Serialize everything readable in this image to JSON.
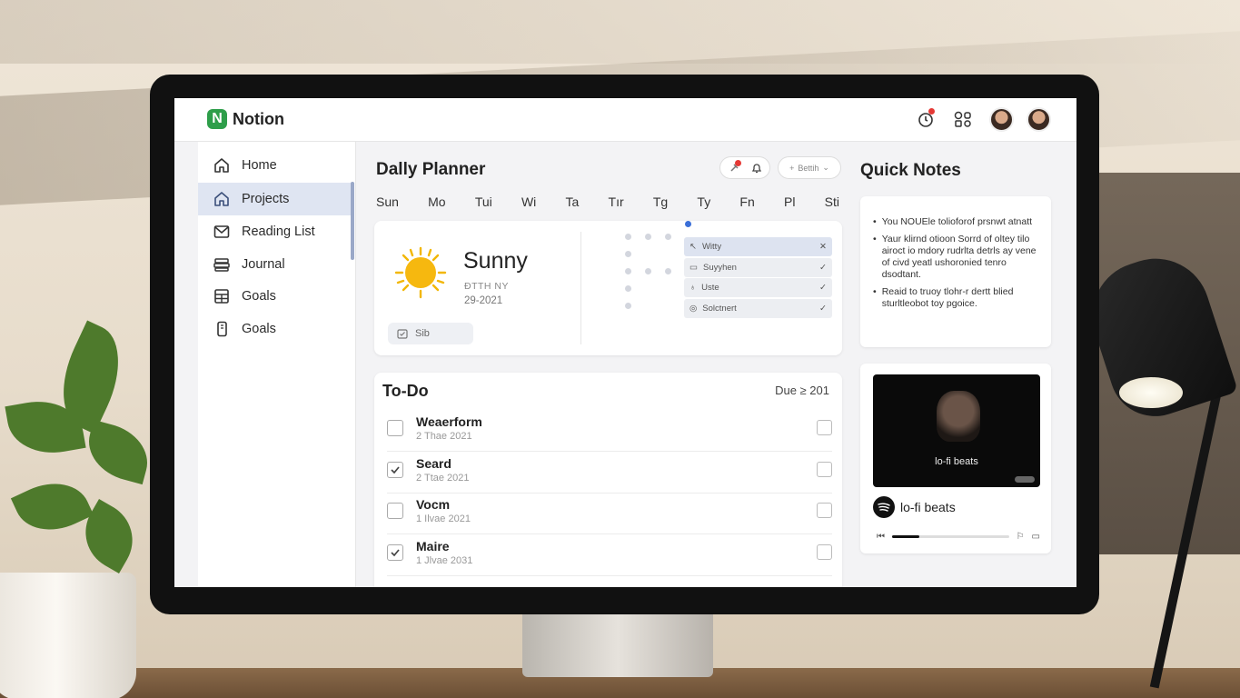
{
  "app": {
    "name": "Notion"
  },
  "sidebar": {
    "items": [
      {
        "label": "Home",
        "icon": "home-icon"
      },
      {
        "label": "Projects",
        "icon": "home-icon",
        "active": true
      },
      {
        "label": "Reading List",
        "icon": "mail-icon"
      },
      {
        "label": "Journal",
        "icon": "stack-icon"
      },
      {
        "label": "Goals",
        "icon": "table-icon"
      },
      {
        "label": "Goals",
        "icon": "phone-icon"
      }
    ]
  },
  "planner": {
    "title": "Dally Planner",
    "filter_label": "Bettih",
    "days": [
      "Sun",
      "Mo",
      "Tui",
      "Wi",
      "Ta",
      "Tır",
      "Tg",
      "Ty",
      "Fn",
      "Pl",
      "Sti"
    ]
  },
  "weather": {
    "condition": "Sunny",
    "meta1": "ÐTTH NY",
    "meta2": "29-2021",
    "chip": "Sib",
    "list": [
      {
        "label": "Witty",
        "mark": "✕"
      },
      {
        "label": "Suyyhen",
        "mark": "✓"
      },
      {
        "label": "Uste",
        "mark": "✓"
      },
      {
        "label": "Solctnert",
        "mark": "✓"
      }
    ]
  },
  "todo": {
    "title": "To-Do",
    "due": "Due ≥ 201",
    "rows": [
      {
        "name": "Weaerform",
        "date": "2 Thae 2021",
        "checked": false
      },
      {
        "name": "Seard",
        "date": "2 Ttae 2021",
        "checked": true
      },
      {
        "name": "Vocm",
        "date": "1 Ilvae 2021",
        "checked": false
      },
      {
        "name": "Maire",
        "date": "1 Jlvae 2031",
        "checked": true
      }
    ]
  },
  "quick_notes": {
    "title": "Quick Notes",
    "notes": [
      "You NOUEle tolioforof prsnwt atnatt",
      "Yaur klirnd otioon Sorrd of oltey tilo airoct io mdory rudrlta detrls ay vene of civd yeatl ushoronied tenro dsodtant.",
      "Reaid to truoy tlohr-r dertt blied sturltleobot toy pgoice."
    ]
  },
  "music": {
    "video_caption": "lo-fi beats",
    "label": "lo-fi beats",
    "progress": 0.23
  },
  "colors": {
    "brand": "#2e9e4a",
    "active_nav": "#dfe5f2",
    "accent_dot": "#3b6fd8",
    "alert": "#e53935"
  }
}
